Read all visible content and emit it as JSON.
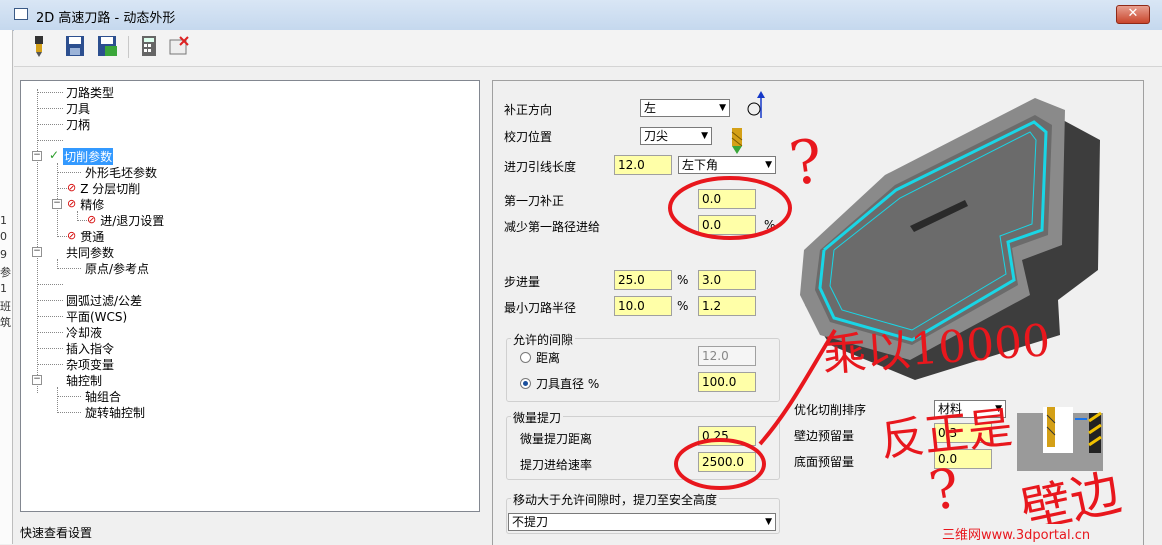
{
  "window": {
    "title": "2D 高速刀路 - 动态外形",
    "close": "✕"
  },
  "left_strip": [
    "1",
    "0",
    "9",
    "参",
    "1",
    "班",
    "筑"
  ],
  "tree": {
    "items": [
      {
        "label": "刀路类型"
      },
      {
        "label": "刀具"
      },
      {
        "label": "刀柄"
      },
      {
        "label": "切削参数",
        "selected": true,
        "status": "✓"
      },
      {
        "label": "外形毛坯参数"
      },
      {
        "label": "Z 分层切削",
        "status": "⊘"
      },
      {
        "label": "精修",
        "status": "⊘"
      },
      {
        "label": "进/退刀设置",
        "status": "⊘"
      },
      {
        "label": "贯通",
        "status": "⊘"
      },
      {
        "label": "共同参数"
      },
      {
        "label": "原点/参考点"
      },
      {
        "label": "圆弧过滤/公差"
      },
      {
        "label": "平面(WCS)"
      },
      {
        "label": "冷却液"
      },
      {
        "label": "插入指令"
      },
      {
        "label": "杂项变量"
      },
      {
        "label": "轴控制"
      },
      {
        "label": "轴组合"
      },
      {
        "label": "旋转轴控制"
      }
    ],
    "expander_open": "−"
  },
  "quick_view": "快速查看设置",
  "params": {
    "comp_dir_label": "补正方向",
    "comp_dir_value": "左",
    "tip_comp_label": "校刀位置",
    "tip_comp_value": "刀尖",
    "lead_len_label": "进刀引线长度",
    "lead_len_value": "12.0",
    "lead_corner_value": "左下角",
    "first_offset_label": "第一刀补正",
    "first_offset_value": "0.0",
    "reduce_first_label": "减少第一路径进给",
    "reduce_first_value": "0.0",
    "percent": "%",
    "stepover_label": "步进量",
    "stepover_pct": "25.0",
    "stepover_val": "3.0",
    "min_radius_label": "最小刀路半径",
    "min_radius_pct": "10.0",
    "min_radius_val": "1.2",
    "gap_group_title": "允许的间隙",
    "gap_distance_label": "距离",
    "gap_distance_value": "12.0",
    "gap_tooldia_label": "刀具直径 %",
    "gap_tooldia_value": "100.0",
    "microlift_title": "微量提刀",
    "microlift_dist_label": "微量提刀距离",
    "microlift_dist_value": "0.25",
    "microlift_feed_label": "提刀进给速率",
    "microlift_feed_value": "2500.0",
    "retract_title": "移动大于允许间隙时，提刀至安全高度",
    "retract_value": "不提刀",
    "optimize_label": "优化切削排序",
    "optimize_value": "材料",
    "wall_stock_label": "壁边预留量",
    "wall_stock_value": "0.3",
    "floor_stock_label": "底面预留量",
    "floor_stock_value": "0.0"
  },
  "annotations": {
    "question1": "?",
    "note_multiply": "乘以10000",
    "note_reverse": "反正是",
    "question2": "?",
    "note_wall": "壁边"
  },
  "watermark": "三维网www.3dportal.cn",
  "colors": {
    "field_yellow": "#ffffa8",
    "selection": "#3399ff",
    "annotation_red": "#e8171d",
    "toolpath_cyan": "#19d6e6"
  }
}
